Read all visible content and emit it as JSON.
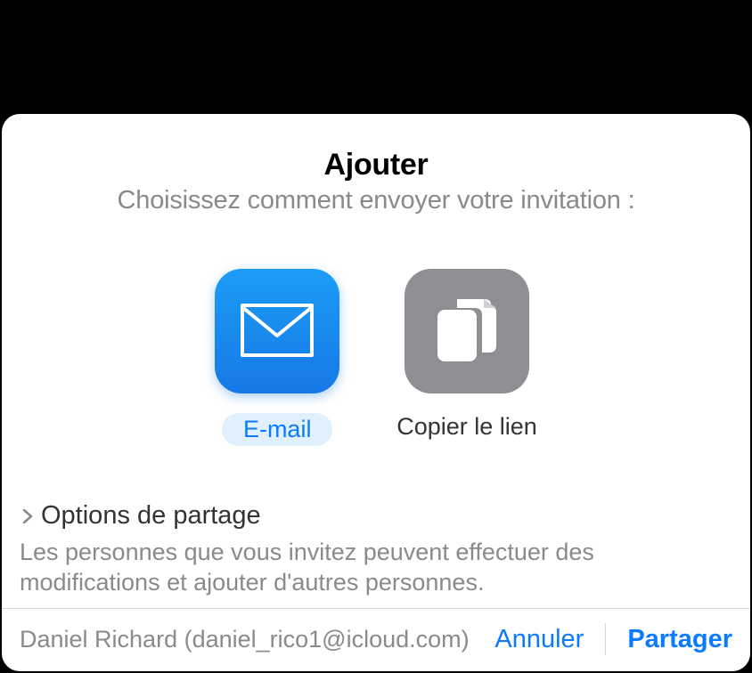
{
  "dialog": {
    "title": "Ajouter",
    "subtitle": "Choisissez comment envoyer votre invitation :",
    "options": {
      "email": {
        "label": "E-mail"
      },
      "copy_link": {
        "label": "Copier le lien"
      }
    },
    "sharing": {
      "header": "Options de partage",
      "description": "Les personnes que vous invitez peuvent effectuer des modifications et ajouter d'autres personnes."
    },
    "footer": {
      "user": "Daniel Richard (daniel_rico1@icloud.com)",
      "cancel": "Annuler",
      "share": "Partager"
    }
  }
}
